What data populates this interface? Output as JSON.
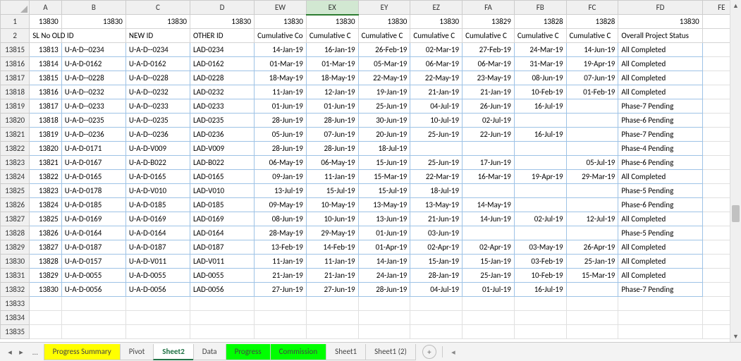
{
  "columns": [
    "A",
    "B",
    "C",
    "D",
    "EW",
    "EX",
    "EY",
    "EZ",
    "FA",
    "FB",
    "FC",
    "FD",
    "FE"
  ],
  "selected_column": "EX",
  "row1_values": [
    "13830",
    "13830",
    "13830",
    "13830",
    "13830",
    "13830",
    "13830",
    "13830",
    "13829",
    "13828",
    "13828",
    "13830",
    ""
  ],
  "row2_headers": [
    "SL No",
    "OLD ID",
    "NEW ID",
    "OTHER ID",
    "Cumulative Co",
    "Cumulative C",
    "Cumulative C",
    "Cumulative C",
    "Cumulative C",
    "Cumulative C",
    "Cumulative C",
    "Overall Project Status",
    ""
  ],
  "row2_ab_combined": "SL No   OLD ID",
  "rows": [
    {
      "rh": "13815",
      "A": "13813",
      "B": "U-A-D--0234",
      "C": "U-A-D--0234",
      "D": "LAD-0234",
      "EW": "14-Jan-19",
      "EX": "16-Jan-19",
      "EY": "26-Feb-19",
      "EZ": "02-Mar-19",
      "FA": "27-Feb-19",
      "FB": "24-Mar-19",
      "FC": "14-Jun-19",
      "FD": "All Completed"
    },
    {
      "rh": "13816",
      "A": "13814",
      "B": "U-A-D-0162",
      "C": "U-A-D-0162",
      "D": "LAD-0162",
      "EW": "01-Mar-19",
      "EX": "01-Mar-19",
      "EY": "05-Mar-19",
      "EZ": "06-Mar-19",
      "FA": "06-Mar-19",
      "FB": "31-Mar-19",
      "FC": "19-Apr-19",
      "FD": "All Completed"
    },
    {
      "rh": "13817",
      "A": "13815",
      "B": "U-A-D--0228",
      "C": "U-A-D--0228",
      "D": "LAD-0228",
      "EW": "18-May-19",
      "EX": "18-May-19",
      "EY": "22-May-19",
      "EZ": "22-May-19",
      "FA": "23-May-19",
      "FB": "08-Jun-19",
      "FC": "07-Jun-19",
      "FD": "All Completed"
    },
    {
      "rh": "13818",
      "A": "13816",
      "B": "U-A-D--0232",
      "C": "U-A-D--0232",
      "D": "LAD-0232",
      "EW": "11-Jan-19",
      "EX": "12-Jan-19",
      "EY": "19-Jan-19",
      "EZ": "21-Jan-19",
      "FA": "21-Jan-19",
      "FB": "10-Feb-19",
      "FC": "01-Feb-19",
      "FD": "All Completed"
    },
    {
      "rh": "13819",
      "A": "13817",
      "B": "U-A-D--0233",
      "C": "U-A-D--0233",
      "D": "LAD-0233",
      "EW": "01-Jun-19",
      "EX": "01-Jun-19",
      "EY": "25-Jun-19",
      "EZ": "04-Jul-19",
      "FA": "26-Jun-19",
      "FB": "16-Jul-19",
      "FC": "",
      "FD": "Phase-7 Pending"
    },
    {
      "rh": "13820",
      "A": "13818",
      "B": "U-A-D--0235",
      "C": "U-A-D--0235",
      "D": "LAD-0235",
      "EW": "28-Jun-19",
      "EX": "28-Jun-19",
      "EY": "30-Jun-19",
      "EZ": "10-Jul-19",
      "FA": "02-Jul-19",
      "FB": "",
      "FC": "",
      "FD": "Phase-6 Pending"
    },
    {
      "rh": "13821",
      "A": "13819",
      "B": "U-A-D--0236",
      "C": "U-A-D--0236",
      "D": "LAD-0236",
      "EW": "05-Jun-19",
      "EX": "07-Jun-19",
      "EY": "20-Jun-19",
      "EZ": "25-Jun-19",
      "FA": "22-Jun-19",
      "FB": "16-Jul-19",
      "FC": "",
      "FD": "Phase-7 Pending"
    },
    {
      "rh": "13822",
      "A": "13820",
      "B": "U-A-D-0171",
      "C": "U-A-D-V009",
      "D": "LAD-V009",
      "EW": "28-Jun-19",
      "EX": "28-Jun-19",
      "EY": "18-Jul-19",
      "EZ": "",
      "FA": "",
      "FB": "",
      "FC": "",
      "FD": "Phase-4 Pending"
    },
    {
      "rh": "13823",
      "A": "13821",
      "B": "U-A-D-0167",
      "C": "U-A-D-B022",
      "D": "LAD-B022",
      "EW": "06-May-19",
      "EX": "06-May-19",
      "EY": "15-Jun-19",
      "EZ": "25-Jun-19",
      "FA": "17-Jun-19",
      "FB": "",
      "FC": "05-Jul-19",
      "FD": "Phase-6 Pending"
    },
    {
      "rh": "13824",
      "A": "13822",
      "B": "U-A-D-0165",
      "C": "U-A-D-0165",
      "D": "LAD-0165",
      "EW": "09-Jan-19",
      "EX": "11-Jan-19",
      "EY": "15-Mar-19",
      "EZ": "22-Mar-19",
      "FA": "16-Mar-19",
      "FB": "19-Apr-19",
      "FC": "29-Mar-19",
      "FD": "All Completed"
    },
    {
      "rh": "13825",
      "A": "13823",
      "B": "U-A-D-0178",
      "C": "U-A-D-V010",
      "D": "LAD-V010",
      "EW": "13-Jul-19",
      "EX": "15-Jul-19",
      "EY": "15-Jul-19",
      "EZ": "18-Jul-19",
      "FA": "",
      "FB": "",
      "FC": "",
      "FD": "Phase-5 Pending"
    },
    {
      "rh": "13826",
      "A": "13824",
      "B": "U-A-D-0185",
      "C": "U-A-D-0185",
      "D": "LAD-0185",
      "EW": "09-May-19",
      "EX": "10-May-19",
      "EY": "13-May-19",
      "EZ": "13-May-19",
      "FA": "14-May-19",
      "FB": "",
      "FC": "",
      "FD": "Phase-6 Pending"
    },
    {
      "rh": "13827",
      "A": "13825",
      "B": "U-A-D-0169",
      "C": "U-A-D-0169",
      "D": "LAD-0169",
      "EW": "08-Jun-19",
      "EX": "10-Jun-19",
      "EY": "13-Jun-19",
      "EZ": "21-Jun-19",
      "FA": "14-Jun-19",
      "FB": "02-Jul-19",
      "FC": "12-Jul-19",
      "FD": "All Completed"
    },
    {
      "rh": "13828",
      "A": "13826",
      "B": "U-A-D-0164",
      "C": "U-A-D-0164",
      "D": "LAD-0164",
      "EW": "28-May-19",
      "EX": "29-May-19",
      "EY": "01-Jun-19",
      "EZ": "03-Jun-19",
      "FA": "",
      "FB": "",
      "FC": "",
      "FD": "Phase-5 Pending"
    },
    {
      "rh": "13829",
      "A": "13827",
      "B": "U-A-D-0187",
      "C": "U-A-D-0187",
      "D": "LAD-0187",
      "EW": "13-Feb-19",
      "EX": "14-Feb-19",
      "EY": "01-Apr-19",
      "EZ": "02-Apr-19",
      "FA": "02-Apr-19",
      "FB": "03-May-19",
      "FC": "26-Apr-19",
      "FD": "All Completed"
    },
    {
      "rh": "13830",
      "A": "13828",
      "B": "U-A-D-0157",
      "C": "U-A-D-V011",
      "D": "LAD-V011",
      "EW": "11-Jan-19",
      "EX": "11-Jan-19",
      "EY": "14-Jan-19",
      "EZ": "15-Jan-19",
      "FA": "15-Jan-19",
      "FB": "03-Feb-19",
      "FC": "25-Jan-19",
      "FD": "All Completed"
    },
    {
      "rh": "13831",
      "A": "13829",
      "B": "U-A-D-0055",
      "C": "U-A-D-0055",
      "D": "LAD-0055",
      "EW": "21-Jan-19",
      "EX": "21-Jan-19",
      "EY": "24-Jan-19",
      "EZ": "28-Jan-19",
      "FA": "25-Jan-19",
      "FB": "10-Feb-19",
      "FC": "15-Mar-19",
      "FD": "All Completed"
    },
    {
      "rh": "13832",
      "A": "13830",
      "B": "U-A-D-0056",
      "C": "U-A-D-0056",
      "D": "LAD-0056",
      "EW": "27-Jun-19",
      "EX": "27-Jun-19",
      "EY": "28-Jun-19",
      "EZ": "04-Jul-19",
      "FA": "01-Jul-19",
      "FB": "16-Jul-19",
      "FC": "",
      "FD": "Phase-7 Pending"
    }
  ],
  "empty_rows": [
    "13833",
    "13834",
    "13835"
  ],
  "tabs": [
    {
      "label": "Progress Summary",
      "class": "yellow"
    },
    {
      "label": "Pivot",
      "class": ""
    },
    {
      "label": "Sheet2",
      "class": "active"
    },
    {
      "label": "Data",
      "class": ""
    },
    {
      "label": "Progress",
      "class": "green"
    },
    {
      "label": "Commission",
      "class": "green"
    },
    {
      "label": "Sheet1",
      "class": ""
    },
    {
      "label": "Sheet1 (2)",
      "class": ""
    }
  ],
  "frozen_rows_label": [
    "1",
    "2"
  ]
}
